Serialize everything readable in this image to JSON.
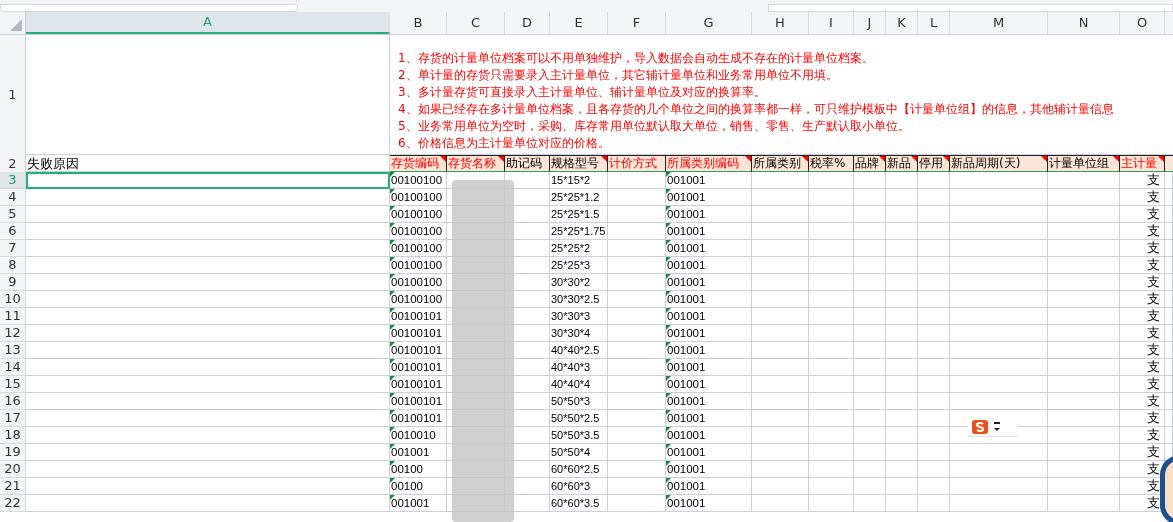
{
  "columns": [
    {
      "letter": "A",
      "selected": true
    },
    {
      "letter": "B",
      "selected": false
    },
    {
      "letter": "C",
      "selected": false
    },
    {
      "letter": "D",
      "selected": false
    },
    {
      "letter": "E",
      "selected": false
    },
    {
      "letter": "F",
      "selected": false
    },
    {
      "letter": "G",
      "selected": false
    },
    {
      "letter": "H",
      "selected": false
    },
    {
      "letter": "I",
      "selected": false
    },
    {
      "letter": "J",
      "selected": false
    },
    {
      "letter": "K",
      "selected": false
    },
    {
      "letter": "L",
      "selected": false
    },
    {
      "letter": "M",
      "selected": false
    },
    {
      "letter": "N",
      "selected": false
    },
    {
      "letter": "O",
      "selected": false
    }
  ],
  "notes_row": {
    "number": "1",
    "lines": [
      "1、存货的计量单位档案可以不用单独维护，导入数据会自动生成不存在的计量单位档案。",
      "2、单计量的存货只需要录入主计量单位，其它辅计量单位和业务常用单位不用填。",
      "3、多计量存货可直接录入主计量单位、辅计量单位及对应的换算率。",
      "4、如果已经存在多计量单位档案，且各存货的几个单位之间的换算率都一样，可只维护模板中【计量单位组】的信息，其他辅计量信息",
      "5、业务常用单位为空时，采购、库存常用单位默认取大单位，销售、零售、生产默认取小单位。",
      "6、价格信息为主计量单位对应的价格。"
    ]
  },
  "header_row": {
    "number": "2",
    "first_cell": "失败原因",
    "fields": [
      {
        "label": "存货编码",
        "required": true,
        "comment": true
      },
      {
        "label": "存货名称",
        "required": true,
        "comment": true
      },
      {
        "label": "助记码",
        "required": false,
        "comment": false
      },
      {
        "label": "规格型号",
        "required": false,
        "comment": true
      },
      {
        "label": "计价方式",
        "required": true,
        "comment": false
      },
      {
        "label": "所属类别编码",
        "required": true,
        "comment": true
      },
      {
        "label": "所属类别",
        "required": false,
        "comment": true
      },
      {
        "label": "税率%",
        "required": false,
        "comment": false
      },
      {
        "label": "品牌",
        "required": false,
        "comment": true
      },
      {
        "label": "新品",
        "required": false,
        "comment": true
      },
      {
        "label": "停用",
        "required": false,
        "comment": true
      },
      {
        "label": "新品周期(天)",
        "required": false,
        "comment": true
      },
      {
        "label": "计量单位组",
        "required": false,
        "comment": true
      },
      {
        "label": "主计量",
        "required": true,
        "comment": true
      }
    ]
  },
  "rows": [
    {
      "number": "3",
      "selected": true,
      "code": "00100100",
      "spec": "15*15*2",
      "category_code": "001001",
      "unit": "支"
    },
    {
      "number": "4",
      "selected": false,
      "code": "00100100",
      "spec": "25*25*1.2",
      "category_code": "001001",
      "unit": "支"
    },
    {
      "number": "5",
      "selected": false,
      "code": "00100100",
      "spec": "25*25*1.5",
      "category_code": "001001",
      "unit": "支"
    },
    {
      "number": "6",
      "selected": false,
      "code": "00100100",
      "spec": "25*25*1.75",
      "category_code": "001001",
      "unit": "支"
    },
    {
      "number": "7",
      "selected": false,
      "code": "00100100",
      "spec": "25*25*2",
      "category_code": "001001",
      "unit": "支"
    },
    {
      "number": "8",
      "selected": false,
      "code": "00100100",
      "spec": "25*25*3",
      "category_code": "001001",
      "unit": "支"
    },
    {
      "number": "9",
      "selected": false,
      "code": "00100100",
      "spec": "30*30*2",
      "category_code": "001001",
      "unit": "支"
    },
    {
      "number": "10",
      "selected": false,
      "code": "00100100",
      "spec": "30*30*2.5",
      "category_code": "001001",
      "unit": "支"
    },
    {
      "number": "11",
      "selected": false,
      "code": "00100101",
      "spec": "30*30*3",
      "category_code": "001001",
      "unit": "支"
    },
    {
      "number": "12",
      "selected": false,
      "code": "00100101",
      "spec": "30*30*4",
      "category_code": "001001",
      "unit": "支"
    },
    {
      "number": "13",
      "selected": false,
      "code": "00100101",
      "spec": "40*40*2.5",
      "category_code": "001001",
      "unit": "支"
    },
    {
      "number": "14",
      "selected": false,
      "code": "00100101",
      "spec": "40*40*3",
      "category_code": "001001",
      "unit": "支"
    },
    {
      "number": "15",
      "selected": false,
      "code": "00100101",
      "spec": "40*40*4",
      "category_code": "001001",
      "unit": "支"
    },
    {
      "number": "16",
      "selected": false,
      "code": "00100101",
      "spec": "50*50*3",
      "category_code": "001001",
      "unit": "支"
    },
    {
      "number": "17",
      "selected": false,
      "code": "00100101",
      "spec": "50*50*2.5",
      "category_code": "001001",
      "unit": "支"
    },
    {
      "number": "18",
      "selected": false,
      "code": "0010010",
      "spec": "50*50*3.5",
      "category_code": "001001",
      "unit": "支"
    },
    {
      "number": "19",
      "selected": false,
      "code": "001001",
      "spec": "50*50*4",
      "category_code": "001001",
      "unit": "支"
    },
    {
      "number": "20",
      "selected": false,
      "code": "00100",
      "spec": "60*60*2.5",
      "category_code": "001001",
      "unit": "支"
    },
    {
      "number": "21",
      "selected": false,
      "code": "00100",
      "spec": "60*60*3",
      "category_code": "001001",
      "unit": "支"
    },
    {
      "number": "22",
      "selected": false,
      "code": "001001",
      "spec": "60*60*3.5",
      "category_code": "001001",
      "unit": "支"
    }
  ]
}
